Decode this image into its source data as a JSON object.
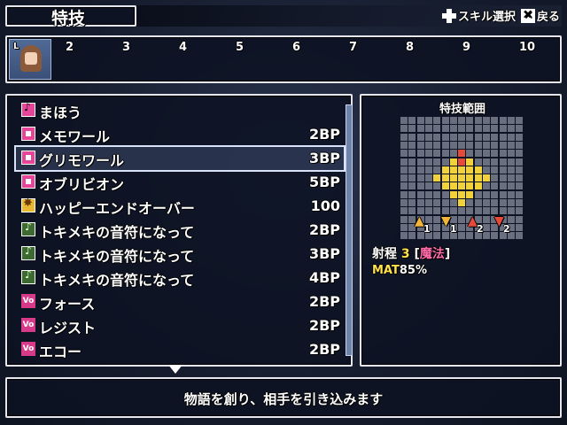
{
  "header": {
    "title": "特技",
    "hint_skill": "スキル選択",
    "hint_back": "戻る"
  },
  "party": {
    "portrait_level": "L",
    "slots": [
      "2",
      "3",
      "4",
      "5",
      "6",
      "7",
      "8",
      "9",
      "10"
    ]
  },
  "skills": [
    {
      "icon": "magic-icon",
      "name": "まほう",
      "cost": ""
    },
    {
      "icon": "pink-square-icon",
      "name": "メモワール",
      "cost": "2BP"
    },
    {
      "icon": "pink-square-icon",
      "name": "グリモワール",
      "cost": "3BP",
      "selected": true
    },
    {
      "icon": "pink-square-icon",
      "name": "オブリビオン",
      "cost": "5BP"
    },
    {
      "icon": "sun-icon",
      "name": "ハッピーエンドオーバー",
      "cost": "100"
    },
    {
      "icon": "note-icon",
      "name": "トキメキの音符になって",
      "cost": "2BP"
    },
    {
      "icon": "note-icon",
      "name": "トキメキの音符になって",
      "cost": "3BP"
    },
    {
      "icon": "note-icon",
      "name": "トキメキの音符になって",
      "cost": "4BP"
    },
    {
      "icon": "vo-icon",
      "name": "フォース",
      "cost": "2BP"
    },
    {
      "icon": "vo-icon",
      "name": "レジスト",
      "cost": "2BP"
    },
    {
      "icon": "vo-icon",
      "name": "エコー",
      "cost": "2BP"
    }
  ],
  "vo_label": "Vo",
  "range": {
    "title": "特技範囲",
    "label": "射程",
    "value": "3",
    "type_open": "[",
    "type": "魔法",
    "type_close": "]",
    "mat_key": "MAT",
    "mat_value": "85%",
    "markers": [
      {
        "dir": "up",
        "n": "1"
      },
      {
        "dir": "down",
        "n": "1"
      },
      {
        "dir": "up",
        "n": "2"
      },
      {
        "dir": "down",
        "n": "2"
      }
    ],
    "colors": {
      "red": "#e84a3a",
      "yellow": "#f2d23a",
      "grid": "#6a6f80"
    }
  },
  "description": "物語を創り、相手を引き込みます"
}
